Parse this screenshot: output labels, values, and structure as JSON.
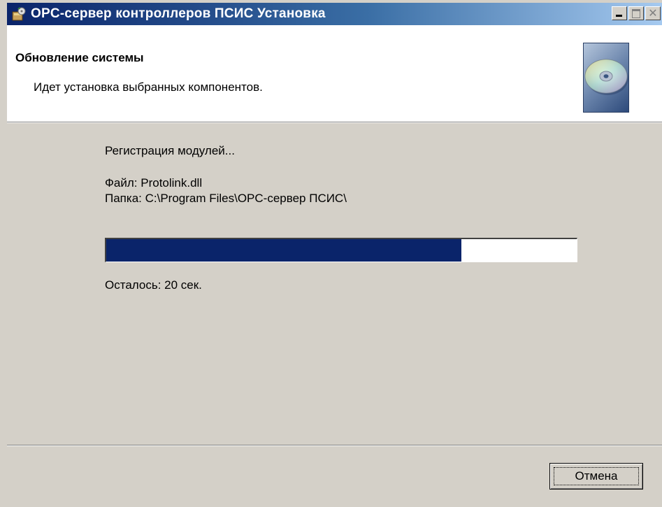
{
  "window": {
    "title": "OPC-сервер контроллеров ПСИС Установка",
    "controls": {
      "minimize_icon": "minimize-icon",
      "maximize_icon": "maximize-icon",
      "close_glyph": "✕"
    }
  },
  "header": {
    "title": "Обновление системы",
    "subtitle": "Идет установка выбранных компонентов.",
    "graphic_icon": "cd-disc-icon"
  },
  "progress_section": {
    "status": "Регистрация модулей...",
    "file_line": "Файл: Protolink.dll",
    "folder_line": "Папка: C:\\Program Files\\OPC-сервер ПСИС\\",
    "progress_fraction": 0.755,
    "remaining": "Осталось: 20 сек."
  },
  "footer": {
    "cancel_label": "Отмена"
  },
  "colors": {
    "titlebar_start": "#0a246a",
    "titlebar_end": "#a6caf0",
    "progress_fill": "#0a246a",
    "dialog_bg": "#d4d0c8"
  }
}
